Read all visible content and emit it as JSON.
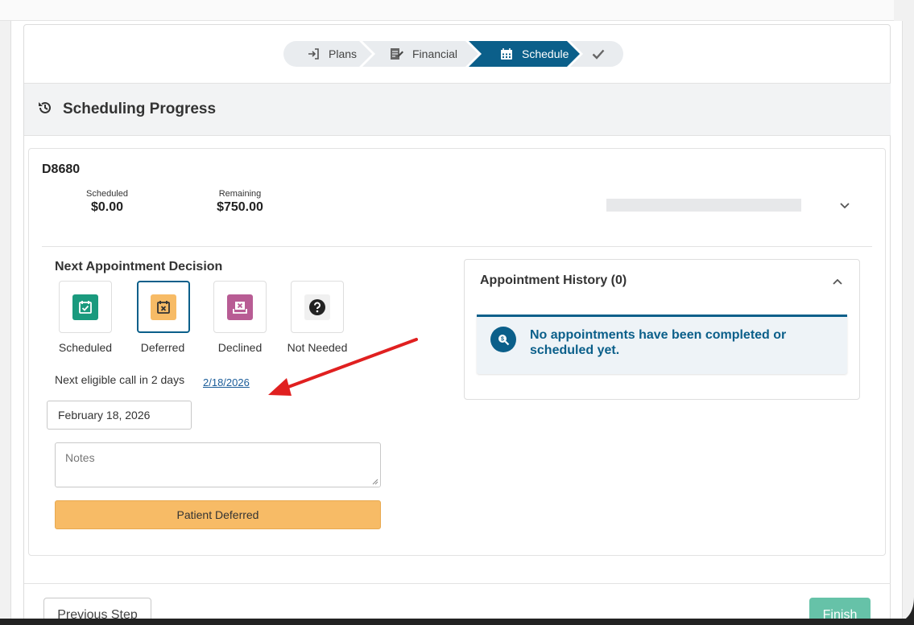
{
  "stepper": {
    "steps": [
      {
        "label": "Plans",
        "icon": "sign-in-icon"
      },
      {
        "label": "Financial",
        "icon": "edit-document-icon"
      },
      {
        "label": "Schedule",
        "icon": "calendar-icon",
        "active": true
      },
      {
        "label": "",
        "icon": "check-icon"
      }
    ]
  },
  "section": {
    "title": "Scheduling Progress",
    "icon": "history-icon"
  },
  "procedure": {
    "code": "D8680",
    "scheduled_label": "Scheduled",
    "scheduled_value": "$0.00",
    "remaining_label": "Remaining",
    "remaining_value": "$750.00"
  },
  "decision": {
    "title": "Next Appointment Decision",
    "options": [
      {
        "label": "Scheduled",
        "icon": "calendar-check-icon",
        "color": "#1a9a7e"
      },
      {
        "label": "Deferred",
        "icon": "calendar-x-icon",
        "color": "#f7bb66",
        "selected": true
      },
      {
        "label": "Declined",
        "icon": "inbox-x-icon",
        "color": "#b85c94"
      },
      {
        "label": "Not Needed",
        "icon": "question-circle-icon",
        "color": "#222222"
      }
    ],
    "eligible_text": "Next eligible call in 2 days",
    "eligible_date": "2/18/2026",
    "date_value": "February 18, 2026",
    "notes_placeholder": "Notes",
    "action_label": "Patient Deferred"
  },
  "history": {
    "title": "Appointment History (0)",
    "empty_message": "No appointments have been completed or scheduled yet."
  },
  "footer": {
    "previous_label": "Previous Step",
    "finish_label": "Finish"
  },
  "colors": {
    "primary": "#0b5f8a",
    "deferred": "#f7bb66",
    "finish": "#66c2a8",
    "annotation_arrow": "#e02020"
  }
}
